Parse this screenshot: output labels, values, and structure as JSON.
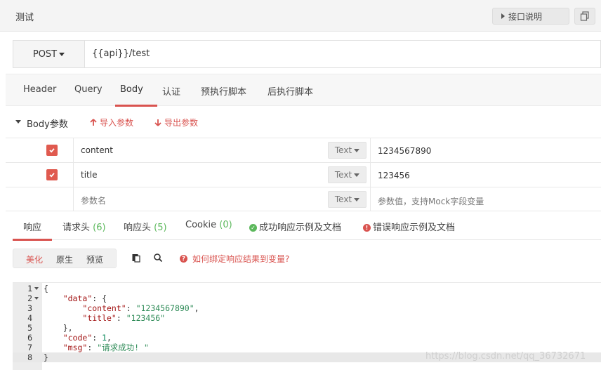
{
  "header": {
    "title": "测试",
    "doc_button": "接口说明"
  },
  "request": {
    "method": "POST",
    "url": "{{api}}/test"
  },
  "request_tabs": [
    {
      "label": "Header"
    },
    {
      "label": "Query"
    },
    {
      "label": "Body",
      "active": true
    },
    {
      "label": "认证"
    },
    {
      "label": "预执行脚本"
    },
    {
      "label": "后执行脚本"
    }
  ],
  "body_section": {
    "label": "Body参数",
    "import_label": "导入参数",
    "export_label": "导出参数"
  },
  "params": [
    {
      "checked": true,
      "name": "content",
      "type": "Text",
      "value": "1234567890"
    },
    {
      "checked": true,
      "name": "title",
      "type": "Text",
      "value": "123456"
    }
  ],
  "new_param": {
    "name_placeholder": "参数名",
    "type": "Text",
    "value_placeholder": "参数值，支持Mock字段变量"
  },
  "response_tabs": {
    "response": "响应",
    "req_headers": "请求头",
    "req_headers_count": "(6)",
    "resp_headers": "响应头",
    "resp_headers_count": "(5)",
    "cookie": "Cookie",
    "cookie_count": "(0)",
    "success_example": "成功响应示例及文档",
    "error_example": "错误响应示例及文档"
  },
  "view_modes": {
    "beautify": "美化",
    "raw": "原生",
    "preview": "预览"
  },
  "help_link": "如何绑定响应结果到变量?",
  "code": {
    "line_numbers": [
      "1",
      "2",
      "3",
      "4",
      "5",
      "6",
      "7",
      "8"
    ],
    "l1": "{",
    "l2_key": "\"data\"",
    "l2_rest": ": {",
    "l3_key": "\"content\"",
    "l3_val": "\"1234567890\"",
    "l4_key": "\"title\"",
    "l4_val": "\"123456\"",
    "l5": "},",
    "l6_key": "\"code\"",
    "l6_val": "1",
    "l7_key": "\"msg\"",
    "l7_val": "\"请求成功! \"",
    "l8": "}"
  },
  "watermark": "https://blog.csdn.net/qq_36732671",
  "colors": {
    "accent": "#d9534f",
    "success": "#5cb85c",
    "checkbox": "#e05a4f"
  }
}
